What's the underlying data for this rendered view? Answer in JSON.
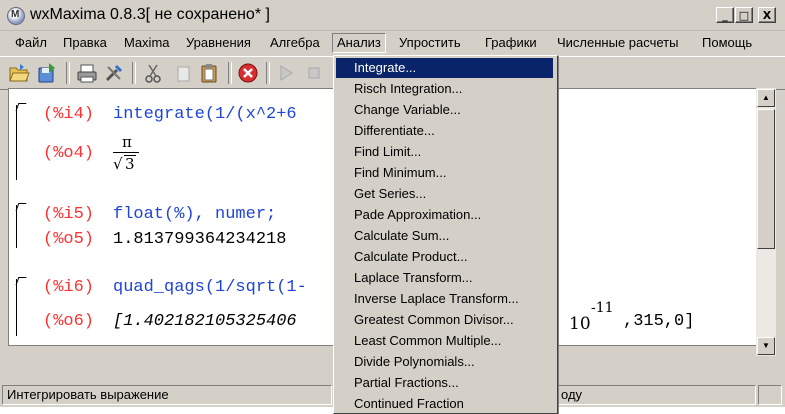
{
  "window": {
    "title": "wxMaxima 0.8.3[ не сохранено* ]",
    "controls": [
      "_",
      "□",
      "X"
    ]
  },
  "menubar": {
    "items": [
      "Файл",
      "Правка",
      "Maxima",
      "Уравнения",
      "Алгебра",
      "Анализ",
      "Упростить",
      "Графики",
      "Численные расчеты",
      "Помощь"
    ],
    "open_item": "Анализ"
  },
  "toolbar": {
    "icons": [
      "open-folder-icon",
      "save-icon",
      "print-icon",
      "config-icon",
      "cut-icon",
      "copy-icon",
      "paste-icon",
      "interrupt-icon",
      "play-icon",
      "stop-icon"
    ]
  },
  "document": {
    "cells": [
      {
        "input_label": "(%i4)",
        "input": "integrate(1/(x^2+6",
        "output_label": "(%o4)",
        "output_num": "π",
        "output_den": "3"
      },
      {
        "input_label": "(%i5)",
        "input": "float(%), numer;",
        "output_label": "(%o5)",
        "output": "1.813799364234218"
      },
      {
        "input_label": "(%i6)",
        "input": "quad_qags(1/sqrt(1-",
        "output_label": "(%o6)",
        "output_start": "[1.402182105325406",
        "output_pow_base": "10",
        "output_exp": "-11",
        "output_end": ",315,0]"
      }
    ]
  },
  "analysis_menu": {
    "selected": "Integrate...",
    "items": [
      "Integrate...",
      "Risch Integration...",
      "Change Variable...",
      "Differentiate...",
      "Find Limit...",
      "Find Minimum...",
      "Get Series...",
      "Pade Approximation...",
      "Calculate Sum...",
      "Calculate Product...",
      "Laplace Transform...",
      "Inverse Laplace Transform...",
      "Greatest Common Divisor...",
      "Least Common Multiple...",
      "Divide Polynomials...",
      "Partial Fractions...",
      "Continued Fraction"
    ]
  },
  "statusbar": {
    "message": "Интегрировать выражение",
    "right_fragment": "оду"
  },
  "colors": {
    "input_label": "#ff3232",
    "input_text": "#1f45d8",
    "menu_highlight": "#0a246a"
  }
}
